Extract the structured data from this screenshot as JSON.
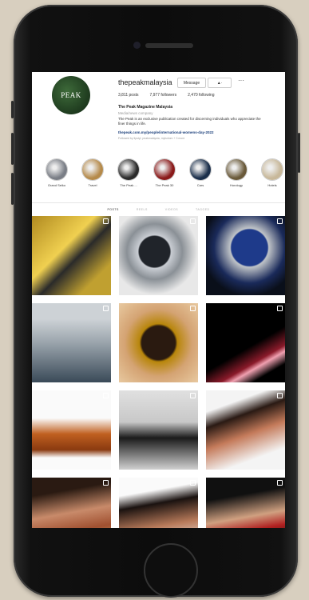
{
  "profile": {
    "username": "thepeakmalaysia",
    "avatar_logo": "PEAK",
    "message_button": "Message",
    "follow_button": "▲·",
    "more_icon": "ellipsis-icon",
    "posts": "3,811 posts",
    "followers": "7,977 followers",
    "following": "2,470 following",
    "display_name": "The Peak Magazine Malaysia",
    "category": "Media/news company",
    "bio": "The Peak is an exclusive publication created for discerning individuals who appreciate the finer things in life.",
    "link": "thepeak.com.my/people/international-womens-day-2022",
    "followed_by": "Followed by lipstyl, peakmalaysia, mylsnlom + 3 more"
  },
  "highlights": [
    {
      "label": "Grand Seiko",
      "color": "#7a7e86"
    },
    {
      "label": "Travel",
      "color": "#b58a4a"
    },
    {
      "label": "The Peak ...",
      "color": "#2a2a2a"
    },
    {
      "label": "The Peak 30",
      "color": "#8a1a1a"
    },
    {
      "label": "Cars",
      "color": "#1a2e4a"
    },
    {
      "label": "Horology",
      "color": "#6a5a3a"
    },
    {
      "label": "Hotels",
      "color": "#c8b89a"
    }
  ],
  "tabs": [
    "POSTS",
    "REELS",
    "VIDEOS",
    "TAGGED"
  ],
  "grid_posts": [
    {
      "name": "post-gold-chronograph",
      "bg": "linear-gradient(135deg,#b08a20,#f0d050 40%,#2a2a2a 55%,#c0a030 80%)"
    },
    {
      "name": "post-silver-watch",
      "bg": "radial-gradient(circle at 45% 45%,#20242a 25%,#c8ccd2 27%,#8a9096 45%,#e8e8e8 70%)"
    },
    {
      "name": "post-blue-dial-watch",
      "bg": "radial-gradient(circle at 55% 40%,#1e3a8a 28%,#c0c4c8 30%,#1a2a5a 55%,#0a0f1a 75%)"
    },
    {
      "name": "post-three-watches",
      "bg": "linear-gradient(180deg,#cdd2d6 20%,#9aa4ac 50%,#3a4a58 100%)"
    },
    {
      "name": "post-gold-lacquer-box",
      "bg": "radial-gradient(circle at 50% 50%,#2a1a10 30%,#b8860b 34%,#d4a373 60%,#e8c9a0 100%)"
    },
    {
      "name": "post-dark-red-light",
      "bg": "linear-gradient(150deg,#000 55%,#8a1a2a 70%,#f0a0b0 75%,#000 85%)"
    },
    {
      "name": "post-cognac-bottle",
      "bg": "linear-gradient(180deg,#fafafa 35%,#c06020 55%,#8a3a10 75%,#fafafa 85%)"
    },
    {
      "name": "post-man-reel",
      "bg": "linear-gradient(180deg,#e0e0e0 0%,#c8c8c8 40%,#1a1a1a 60%,#d0d0d0 100%)"
    },
    {
      "name": "post-woman-portrait",
      "bg": "linear-gradient(160deg,#f4f4f4 20%,#2a1a14 35%,#c47a5a 55%,#f4f4f4 80%)"
    },
    {
      "name": "post-woman-makeup",
      "bg": "linear-gradient(170deg,#2a1a12 20%,#c88a6a 45%,#a05030 65%,#c8a060 90%)"
    },
    {
      "name": "post-woman-profile",
      "bg": "linear-gradient(170deg,#fafafa 20%,#1a1210 35%,#b87a5a 60%,#fafafa 90%)"
    },
    {
      "name": "post-woman-red-lips",
      "bg": "linear-gradient(170deg,#101010 25%,#d0a080 50%,#b02020 65%,#101010 85%)"
    }
  ]
}
